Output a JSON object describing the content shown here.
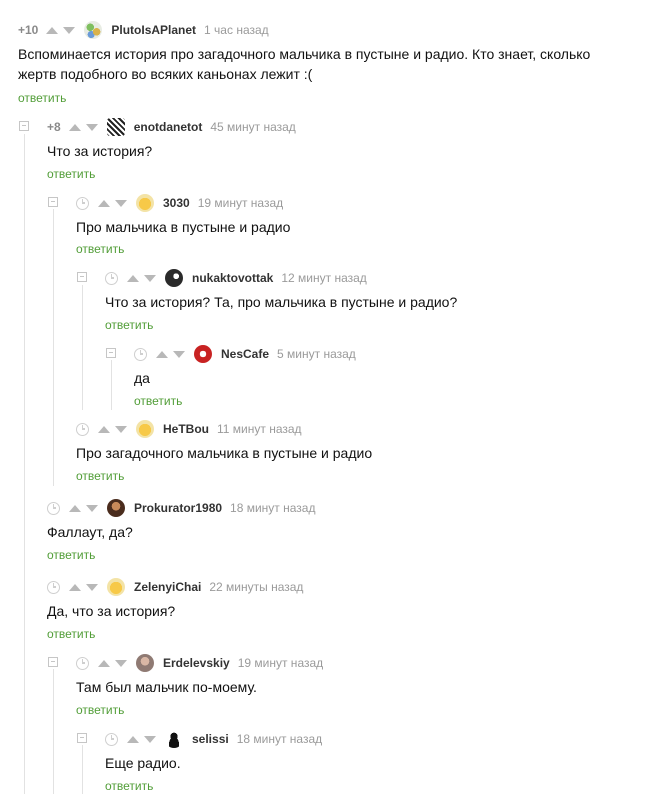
{
  "reply_label": "ответить",
  "colors": {
    "reply": "#519d37",
    "meta": "#9a9a9a",
    "author": "#333333",
    "icon": "#c6c6c6"
  },
  "comments": [
    {
      "score": "+10",
      "author": "PlutoIsAPlanet",
      "time": "1 час назад",
      "text": "Вспоминается история про загадочного мальчика в пустыне и радио. Кто знает, сколько жертв подобного во всяких каньонах лежит :("
    },
    {
      "score": "+8",
      "author": "enotdanetot",
      "time": "45 минут назад",
      "text": "Что за история?"
    },
    {
      "author": "3030",
      "time": "19 минут назад",
      "text": "Про мальчика в пустыне и радио"
    },
    {
      "author": "nukaktovottak",
      "time": "12 минут назад",
      "text": "Что за история? Та, про мальчика в пустыне и радио?"
    },
    {
      "author": "NesCafe",
      "time": "5 минут назад",
      "text": "да"
    },
    {
      "author": "HeTBou",
      "time": "11 минут назад",
      "text": "Про загадочного мальчика в пустыне и радио"
    },
    {
      "author": "Prokurator1980",
      "time": "18 минут назад",
      "text": "Фаллаут, да?"
    },
    {
      "author": "ZelenyiChai",
      "time": "22 минуты назад",
      "text": "Да, что за история?"
    },
    {
      "author": "Erdelevskiy",
      "time": "19 минут назад",
      "text": "Там был мальчик по-моему."
    },
    {
      "author": "selissi",
      "time": "18 минут назад",
      "text": "Еще радио."
    }
  ]
}
